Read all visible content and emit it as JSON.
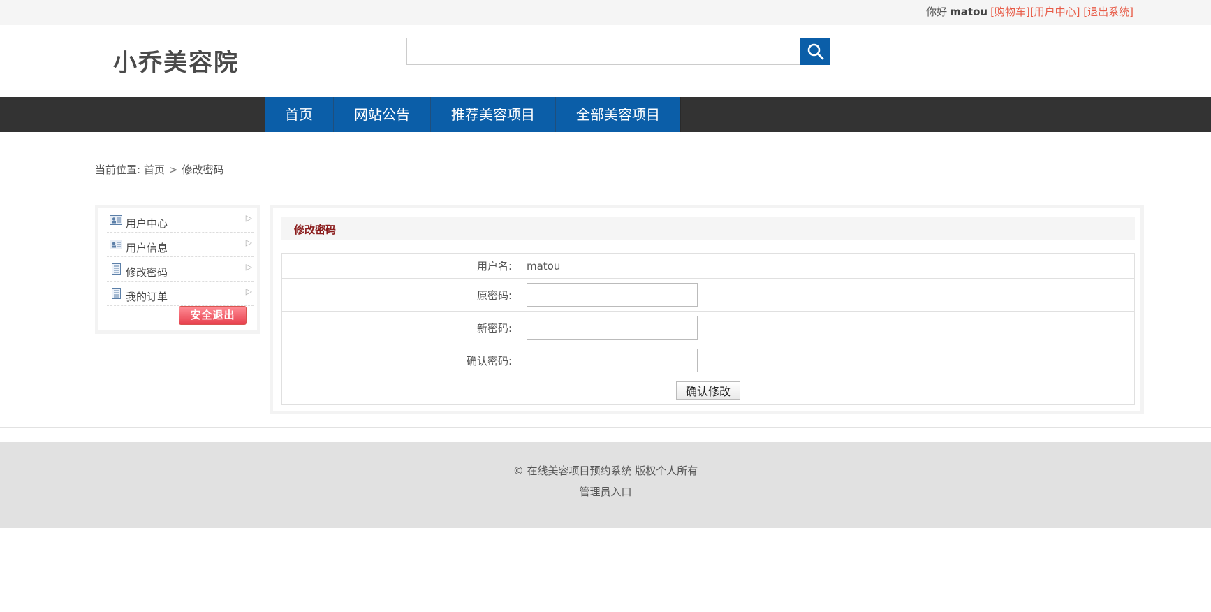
{
  "topbar": {
    "greeting": "你好",
    "username": "matou",
    "cart_link": "[购物车]",
    "user_center_link": "[用户中心]",
    "logout_link": "[退出系统]"
  },
  "header": {
    "logo": "小乔美容院",
    "search": {
      "placeholder": "",
      "value": ""
    },
    "search_icon": "search-icon"
  },
  "nav": {
    "items": [
      {
        "label": "首页"
      },
      {
        "label": "网站公告"
      },
      {
        "label": "推荐美容项目"
      },
      {
        "label": "全部美容项目"
      }
    ]
  },
  "breadcrumb": {
    "prefix": "当前位置:",
    "home": "首页",
    "current": "修改密码"
  },
  "sidebar": {
    "items": [
      {
        "label": "用户中心",
        "icon": "user-card-icon"
      },
      {
        "label": "用户信息",
        "icon": "user-card-icon"
      },
      {
        "label": "修改密码",
        "icon": "document-icon"
      },
      {
        "label": "我的订单",
        "icon": "document-icon"
      }
    ],
    "logout_button": "安全退出"
  },
  "form": {
    "title": "修改密码",
    "username_label": "用户名:",
    "username_value": "matou",
    "old_password_label": "原密码:",
    "new_password_label": "新密码:",
    "confirm_password_label": "确认密码:",
    "submit_label": "确认修改"
  },
  "footer": {
    "copyright": "© 在线美容项目预约系统 版权个人所有",
    "admin_link": "管理员入口"
  },
  "colors": {
    "nav_blue": "#0b5ea8",
    "nav_bar": "#333333",
    "link_red": "#e85c48",
    "title_dark_red": "#8a1c1c"
  }
}
